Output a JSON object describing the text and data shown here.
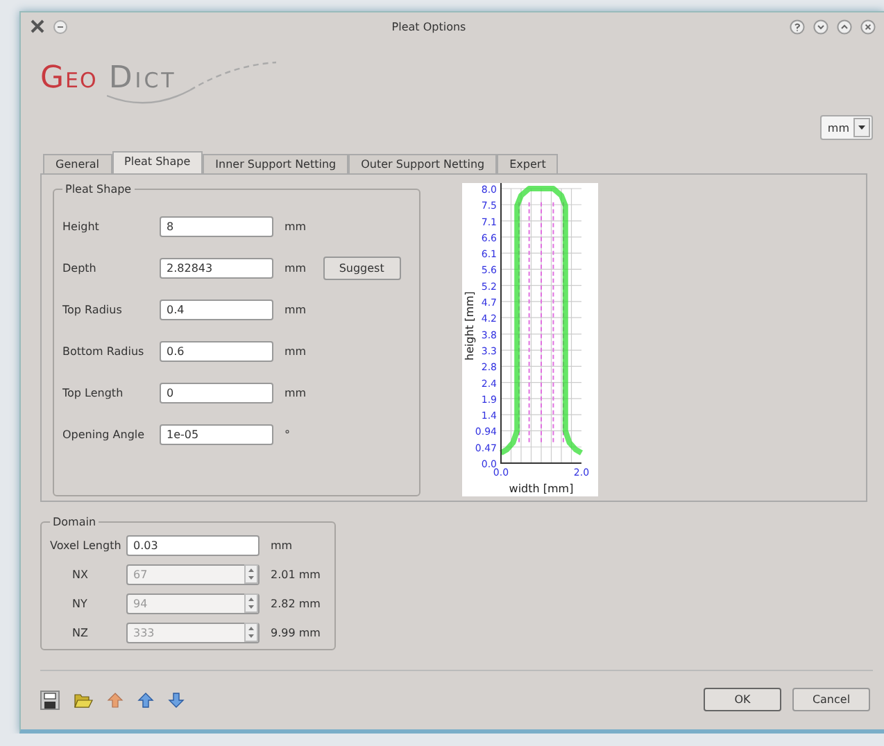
{
  "window": {
    "title": "Pleat Options"
  },
  "logo": {
    "first": "Geo",
    "second": "Dict"
  },
  "unit_select": {
    "value": "mm"
  },
  "tabs": [
    {
      "label": "General",
      "selected": false
    },
    {
      "label": "Pleat Shape",
      "selected": true
    },
    {
      "label": "Inner Support Netting",
      "selected": false
    },
    {
      "label": "Outer Support Netting",
      "selected": false
    },
    {
      "label": "Expert",
      "selected": false
    }
  ],
  "pleat_shape": {
    "title": "Pleat Shape",
    "fields": [
      {
        "label": "Height",
        "value": "8",
        "unit": "mm"
      },
      {
        "label": "Depth",
        "value": "2.82843",
        "unit": "mm",
        "button": "Suggest"
      },
      {
        "label": "Top Radius",
        "value": "0.4",
        "unit": "mm"
      },
      {
        "label": "Bottom Radius",
        "value": "0.6",
        "unit": "mm"
      },
      {
        "label": "Top Length",
        "value": "0",
        "unit": "mm"
      },
      {
        "label": "Opening Angle",
        "value": "1e-05",
        "unit": "°"
      }
    ]
  },
  "preview": {
    "chart_data": {
      "type": "line",
      "xlabel": "width [mm]",
      "ylabel": "height [mm]",
      "x": [
        0.0,
        0.15,
        0.3,
        0.4,
        0.4,
        0.5,
        0.7,
        1.0,
        1.3,
        1.5,
        1.6,
        1.6,
        1.7,
        1.85,
        2.0
      ],
      "grid": true,
      "ref_lines": [
        {
          "axis": "x",
          "value": 0.45,
          "color": "#e070e0"
        },
        {
          "axis": "x",
          "value": 0.7,
          "color": "#e070e0"
        },
        {
          "axis": "x",
          "value": 1.0,
          "color": "#e070e0"
        },
        {
          "axis": "x",
          "value": 1.3,
          "color": "#e070e0"
        },
        {
          "axis": "x",
          "value": 1.55,
          "color": "#e070e0"
        }
      ],
      "series": [
        {
          "color": "#33dd33",
          "values": [
            0.3,
            0.4,
            0.6,
            0.94,
            7.5,
            7.8,
            8.0,
            8.0,
            8.0,
            7.8,
            7.5,
            0.94,
            0.6,
            0.4,
            0.3
          ]
        }
      ],
      "xlim": [
        0,
        2
      ],
      "ylim": [
        0,
        8
      ],
      "xticks": [
        {
          "value": 0,
          "label": "0.0"
        },
        {
          "value": 2,
          "label": "2.0"
        }
      ],
      "yticks": [
        {
          "value": 0,
          "label": "0.0"
        },
        {
          "value": 0.47,
          "label": "0.47"
        },
        {
          "value": 0.94,
          "label": "0.94"
        },
        {
          "value": 1.41,
          "label": "1.4"
        },
        {
          "value": 1.88,
          "label": "1.9"
        },
        {
          "value": 2.35,
          "label": "2.4"
        },
        {
          "value": 2.82,
          "label": "2.8"
        },
        {
          "value": 3.29,
          "label": "3.3"
        },
        {
          "value": 3.76,
          "label": "3.8"
        },
        {
          "value": 4.24,
          "label": "4.2"
        },
        {
          "value": 4.71,
          "label": "4.7"
        },
        {
          "value": 5.18,
          "label": "5.2"
        },
        {
          "value": 5.65,
          "label": "5.6"
        },
        {
          "value": 6.12,
          "label": "6.1"
        },
        {
          "value": 6.59,
          "label": "6.6"
        },
        {
          "value": 7.06,
          "label": "7.1"
        },
        {
          "value": 7.53,
          "label": "7.5"
        },
        {
          "value": 8,
          "label": "8.0"
        }
      ]
    }
  },
  "domain": {
    "title": "Domain",
    "rows": [
      {
        "kind": "field",
        "label": "Voxel Length",
        "value": "0.03",
        "unit": "mm"
      },
      {
        "kind": "spin",
        "label": "NX",
        "value": "67",
        "unit": "2.01 mm",
        "disabled": true
      },
      {
        "kind": "spin",
        "label": "NY",
        "value": "94",
        "unit": "2.82 mm",
        "disabled": true
      },
      {
        "kind": "spin",
        "label": "NZ",
        "value": "333",
        "unit": "9.99 mm",
        "disabled": true
      }
    ]
  },
  "toolbar": [
    {
      "kind": "save"
    },
    {
      "kind": "open"
    },
    {
      "kind": "up-orange"
    },
    {
      "kind": "up"
    },
    {
      "kind": "down"
    }
  ],
  "buttons": [
    {
      "label": "OK",
      "default": true
    },
    {
      "label": "Cancel",
      "default": false
    }
  ]
}
